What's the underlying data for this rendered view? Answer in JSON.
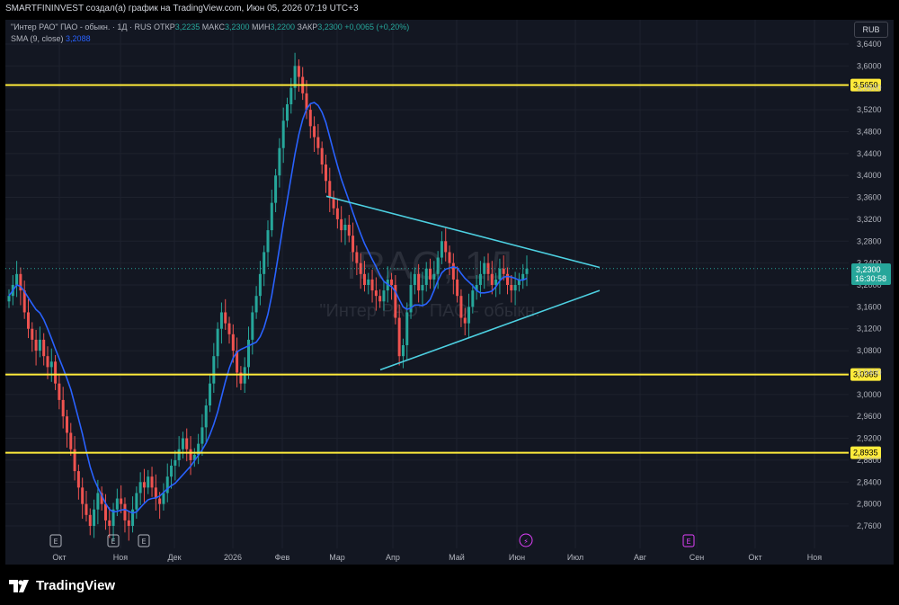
{
  "header": {
    "text": "SMARTFININVEST создал(а) график на TradingView.com, Июн 05, 2026 07:19 UTC+3"
  },
  "legend": {
    "symbol": "\"Интер РАО\" ПАО - обыкн. · 1Д · RUS",
    "open_label": "ОТКР",
    "open": "3,2235",
    "high_label": "МАКС",
    "high": "3,2300",
    "low_label": "МИН",
    "low": "3,2200",
    "close_label": "ЗАКР",
    "close": "3,2300",
    "change": "+0,0065 (+0,20%)",
    "sma_label": "SMA (9, close)",
    "sma_value": "3,2088"
  },
  "currency": "RUB",
  "watermark": {
    "ticker": "IRAO, 1Д",
    "name": "\"Интер РАО\" ПАО - обыкн."
  },
  "price_badge": {
    "value": "3,2300",
    "timer": "16:30:58"
  },
  "brand": "TradingView",
  "colors": {
    "up": "#26a69a",
    "down": "#ef5350",
    "sma": "#2962ff",
    "level": "#ffeb3b",
    "triangle": "#4dd0e1"
  },
  "chart_data": {
    "type": "candlestick",
    "y_ticks": [
      "3,6400",
      "3,6000",
      "3,5600",
      "3,5200",
      "3,4800",
      "3,4400",
      "3,4000",
      "3,3600",
      "3,3200",
      "3,2800",
      "3,2400",
      "3,2000",
      "3,1600",
      "3,1200",
      "3,0800",
      "3,0400",
      "3,0000",
      "2,9600",
      "2,9200",
      "2,8800",
      "2,8400",
      "2,8000",
      "2,7600"
    ],
    "x_labels": [
      "Окт",
      "Ноя",
      "Дек",
      "2026",
      "Фев",
      "Мар",
      "Апр",
      "Май",
      "Июн",
      "Июл",
      "Авг",
      "Сен",
      "Окт",
      "Ноя"
    ],
    "levels": [
      "3,5650",
      "3,0365",
      "2,8935"
    ],
    "ylim": [
      2.74,
      3.66
    ],
    "triangle": {
      "upper": [
        [
          3.362,
          3.232
        ]
      ],
      "lower": [
        [
          3.045,
          3.19
        ]
      ]
    },
    "events": [
      "E",
      "E",
      "E",
      "⚡",
      "E"
    ],
    "closes": [
      3.18,
      3.2,
      3.22,
      3.19,
      3.15,
      3.12,
      3.1,
      3.08,
      3.1,
      3.07,
      3.05,
      3.06,
      3.02,
      2.99,
      2.96,
      2.93,
      2.9,
      2.86,
      2.83,
      2.8,
      2.78,
      2.76,
      2.79,
      2.82,
      2.8,
      2.77,
      2.76,
      2.79,
      2.81,
      2.8,
      2.77,
      2.76,
      2.79,
      2.82,
      2.84,
      2.83,
      2.85,
      2.83,
      2.81,
      2.8,
      2.82,
      2.85,
      2.87,
      2.88,
      2.9,
      2.92,
      2.9,
      2.88,
      2.89,
      2.91,
      2.94,
      2.98,
      3.02,
      3.07,
      3.12,
      3.15,
      3.13,
      3.11,
      3.08,
      3.04,
      3.02,
      3.05,
      3.1,
      3.15,
      3.18,
      3.22,
      3.26,
      3.3,
      3.35,
      3.4,
      3.45,
      3.5,
      3.53,
      3.56,
      3.6,
      3.58,
      3.55,
      3.52,
      3.49,
      3.47,
      3.45,
      3.42,
      3.39,
      3.36,
      3.34,
      3.32,
      3.3,
      3.31,
      3.29,
      3.26,
      3.24,
      3.22,
      3.2,
      3.21,
      3.19,
      3.18,
      3.17,
      3.19,
      3.21,
      3.2,
      3.14,
      3.07,
      3.09,
      3.15,
      3.2,
      3.22,
      3.19,
      3.2,
      3.23,
      3.21,
      3.22,
      3.25,
      3.28,
      3.26,
      3.24,
      3.21,
      3.18,
      3.14,
      3.13,
      3.16,
      3.19,
      3.2,
      3.22,
      3.24,
      3.22,
      3.2,
      3.21,
      3.23,
      3.22,
      3.2,
      3.19,
      3.2,
      3.21,
      3.22,
      3.23
    ]
  }
}
